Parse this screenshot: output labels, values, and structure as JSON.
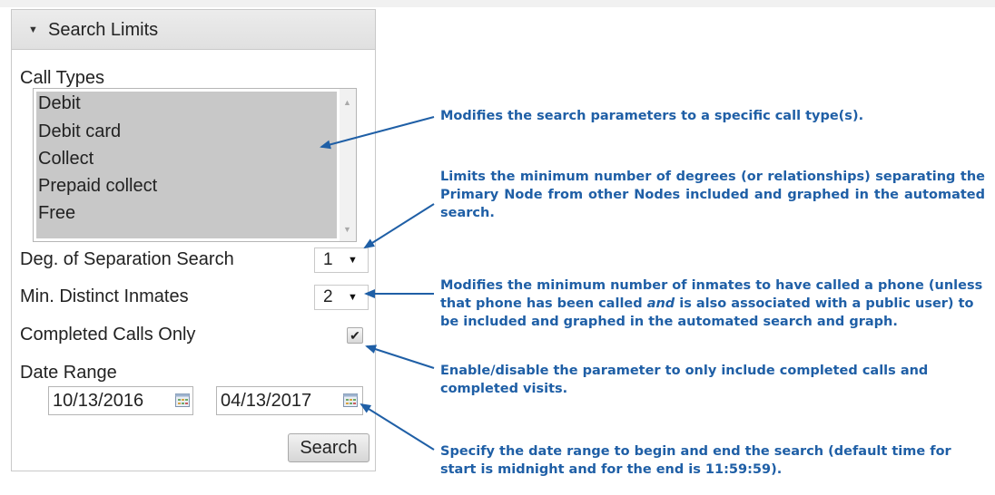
{
  "panel": {
    "title": "Search Limits",
    "call_types_label": "Call Types",
    "call_types": [
      "Debit",
      "Debit card",
      "Collect",
      "Prepaid collect",
      "Free"
    ],
    "deg_separation_label": "Deg. of Separation Search",
    "deg_separation_value": "1",
    "min_inmates_label": "Min. Distinct Inmates",
    "min_inmates_value": "2",
    "completed_calls_label": "Completed Calls Only",
    "completed_calls_checked": true,
    "completed_calls_mark": "✔",
    "date_range_label": "Date Range",
    "date_start": "10/13/2016",
    "date_end": "04/13/2017",
    "search_button": "Search"
  },
  "annotations": {
    "call_types_note": "Modifies the search parameters to a specific call type(s).",
    "deg_separation_note": "Limits the minimum number of degrees (or relationships) separating the Primary Node from other Nodes included and graphed in the automated search.",
    "min_inmates_note_before": "Modifies the minimum number of inmates to have called a phone (unless that phone has been called ",
    "min_inmates_note_em": "and",
    "min_inmates_note_after": " is also associated with a public user) to be included and graphed in the automated search and graph.",
    "completed_calls_note": "Enable/disable the parameter to only include completed calls and completed visits.",
    "date_range_note": "Specify the date range to begin and end the search (default time for start is midnight and for the end is 11:59:59)."
  },
  "colors": {
    "annotation": "#1f5fa6",
    "selected_option_bg": "#c8c8c8"
  },
  "icons": {
    "collapse": "triangle-down-icon",
    "calendar": "calendar-icon",
    "select_arrow": "dropdown-arrow-icon"
  }
}
